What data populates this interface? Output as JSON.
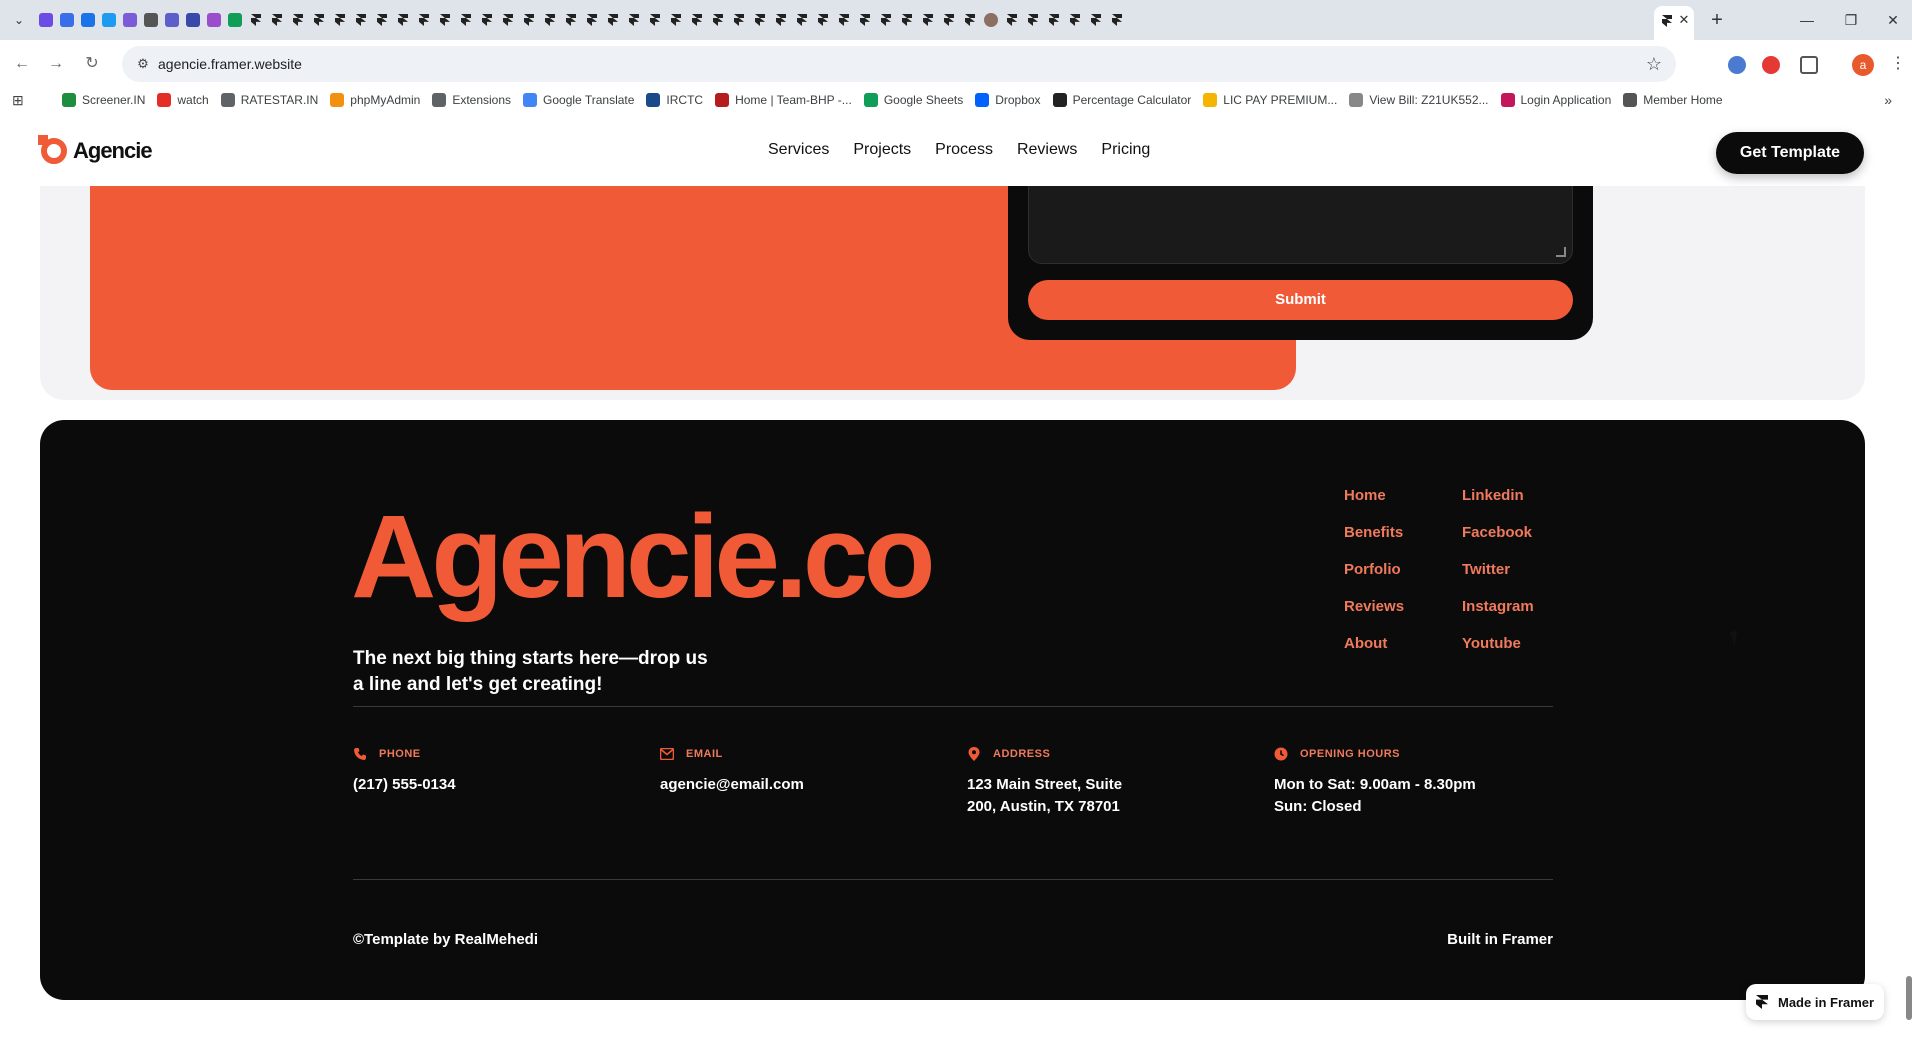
{
  "browser": {
    "tab_count_visible": 52,
    "active_tab_close": "✕",
    "new_tab": "+",
    "window_controls": {
      "minimize": "—",
      "restore": "❐",
      "close": "✕"
    },
    "url": "agencie.framer.website",
    "profile_initial": "a",
    "bookmarks": [
      {
        "label": "Screener.IN",
        "color": "#1e8e3e"
      },
      {
        "label": "watch",
        "color": "#e52d27"
      },
      {
        "label": "RATESTAR.IN",
        "color": "#5f6368"
      },
      {
        "label": "phpMyAdmin",
        "color": "#f29111"
      },
      {
        "label": "Extensions",
        "color": "#5f6368"
      },
      {
        "label": "Google Translate",
        "color": "#4285f4"
      },
      {
        "label": "IRCTC",
        "color": "#1a4a8a"
      },
      {
        "label": "Home | Team-BHP -...",
        "color": "#b71c1c"
      },
      {
        "label": "Google Sheets",
        "color": "#0f9d58"
      },
      {
        "label": "Dropbox",
        "color": "#0061ff"
      },
      {
        "label": "Percentage Calculator",
        "color": "#222222"
      },
      {
        "label": "LIC PAY PREMIUM...",
        "color": "#f4b400"
      },
      {
        "label": "View Bill: Z21UK552...",
        "color": "#888888"
      },
      {
        "label": "Login Application",
        "color": "#c2185b"
      },
      {
        "label": "Member Home",
        "color": "#555555"
      }
    ]
  },
  "site": {
    "logo_text": "Agencie",
    "nav": [
      "Services",
      "Projects",
      "Process",
      "Reviews",
      "Pricing"
    ],
    "cta": "Get Template",
    "submit": "Submit",
    "footer": {
      "brand": "Agencie.co",
      "tagline": "The next big thing starts here—drop us a line and let's get creating!",
      "links_col1": [
        "Home",
        "Benefits",
        "Porfolio",
        "Reviews",
        "About"
      ],
      "links_col2": [
        "Linkedin",
        "Facebook",
        "Twitter",
        "Instagram",
        "Youtube"
      ],
      "info": [
        {
          "label": "PHONE",
          "icon": "phone-icon",
          "value": "(217) 555-0134"
        },
        {
          "label": "EMAIL",
          "icon": "mail-icon",
          "value": "agencie@email.com"
        },
        {
          "label": "ADDRESS",
          "icon": "location-pin-icon",
          "value": "123 Main Street, Suite 200, Austin, TX 78701"
        },
        {
          "label": "OPENING HOURS",
          "icon": "clock-icon",
          "value_line1": "Mon to Sat: 9.00am - 8.30pm",
          "value_line2": "Sun: Closed"
        }
      ],
      "copyright": "©Template by RealMehedi",
      "built": "Built in Framer"
    },
    "badge": "Made in Framer"
  },
  "colors": {
    "accent": "#f05a36",
    "dark": "#0b0b0b",
    "link": "#f07a5c"
  }
}
